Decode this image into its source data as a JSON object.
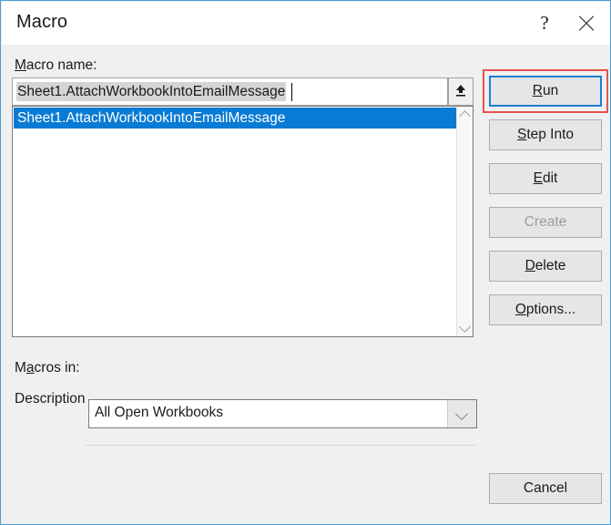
{
  "window": {
    "title": "Macro",
    "help_icon": "question-mark-icon",
    "close_icon": "close-icon"
  },
  "macro_name": {
    "label_prefix": "M",
    "label_rest": "acro name:",
    "value": "Sheet1.AttachWorkbookIntoEmailMessage",
    "placeholder": "",
    "upload_icon": "up-arrow-icon"
  },
  "macro_list": {
    "items": [
      {
        "label": "Sheet1.AttachWorkbookIntoEmailMessage",
        "selected": true
      }
    ],
    "scroll_up_icon": "chevron-up-icon",
    "scroll_down_icon": "chevron-down-icon"
  },
  "macros_in": {
    "label_prefix": "M",
    "label_accel": "a",
    "label_rest": "cros in:",
    "value": "All Open Workbooks",
    "dropdown_icon": "chevron-down-icon"
  },
  "description": {
    "label": "Description"
  },
  "buttons": {
    "run": {
      "accel": "R",
      "rest": "un"
    },
    "step_into": {
      "accel": "S",
      "rest": "tep Into"
    },
    "edit": {
      "accel": "E",
      "rest": "dit"
    },
    "create": {
      "label": "Create",
      "disabled": true
    },
    "delete": {
      "accel": "D",
      "rest": "elete"
    },
    "options": {
      "accel": "O",
      "rest": "ptions..."
    },
    "cancel": {
      "label": "Cancel"
    }
  },
  "colors": {
    "selection_blue": "#0a7bd4",
    "focus_blue": "#1a7fd4",
    "annotation_red": "#e8534f",
    "window_border": "#4a9ed6",
    "dialog_background": "#f0f0f0"
  }
}
